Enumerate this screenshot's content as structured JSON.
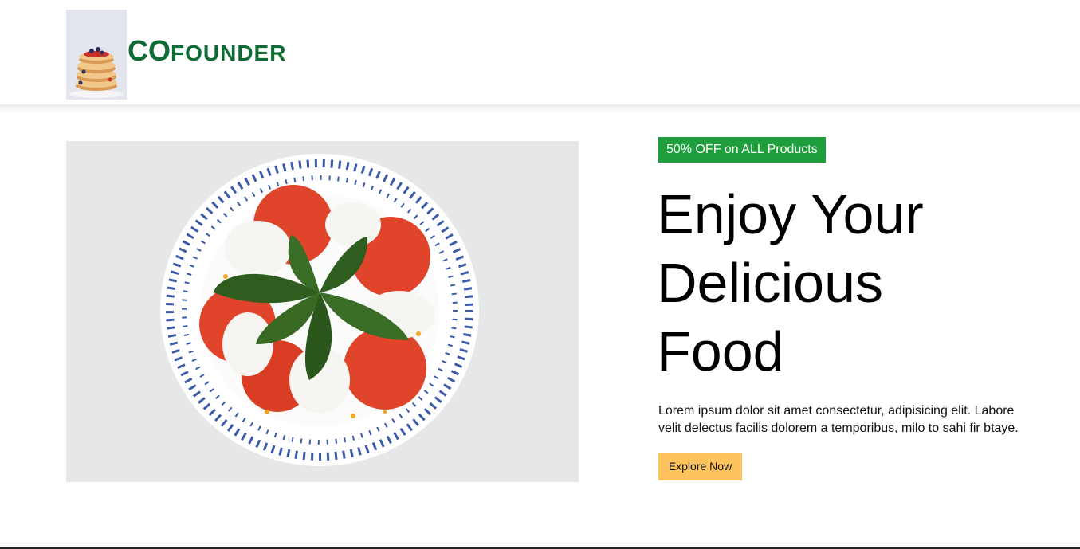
{
  "header": {
    "brand_big": "CO",
    "brand_small": "FOUNDER",
    "logo_icon": "pancake-stack-image"
  },
  "hero": {
    "image_icon": "caprese-salad-plate-image",
    "badge": "50% OFF on ALL Products",
    "headline_lines": [
      "Enjoy Your",
      "Delicious",
      "Food"
    ],
    "description": "Lorem ipsum dolor sit amet consectetur, adipisicing elit. Labore velit delectus facilis dolorem a temporibus, milo to sahi fir btaye.",
    "cta_label": "Explore Now"
  },
  "colors": {
    "brand_green": "#0d6b33",
    "badge_green": "#1e9e3c",
    "cta_yellow": "#ffc35e"
  }
}
